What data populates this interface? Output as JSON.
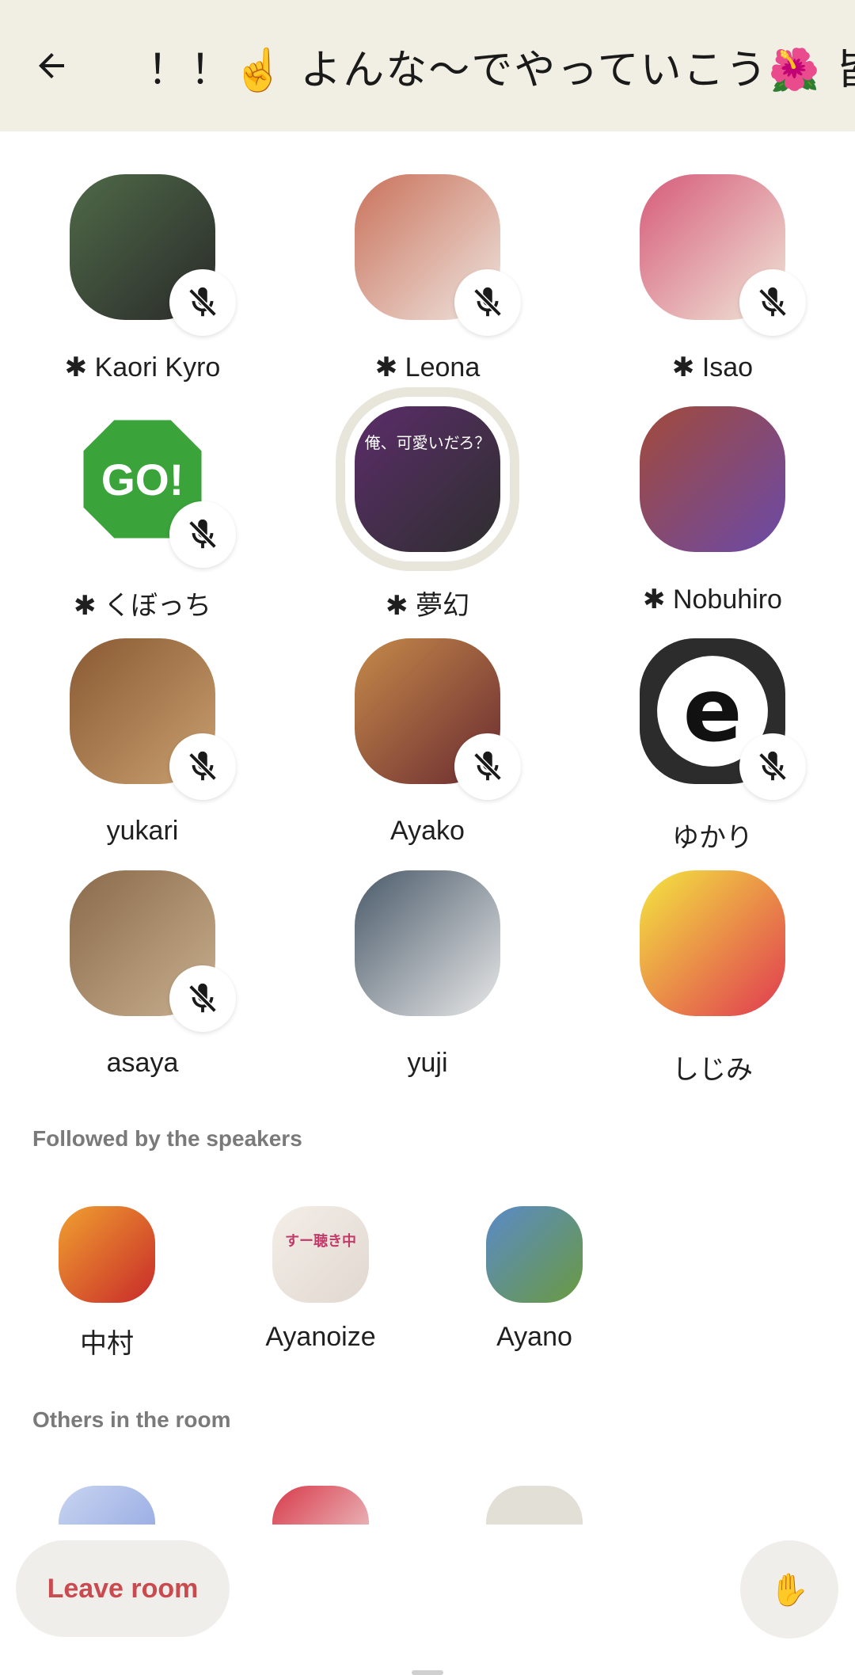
{
  "header": {
    "title": "！！☝️ よんな〜でやっていこう🌺 皆"
  },
  "speakers": [
    {
      "name": "✱ Kaori Kyro",
      "muted": true,
      "bg": [
        "#4f6a48",
        "#2a2a2a"
      ]
    },
    {
      "name": "✱ Leona",
      "muted": true,
      "bg": [
        "#c9725a",
        "#efe5e0"
      ]
    },
    {
      "name": "✱ Isao",
      "muted": true,
      "bg": [
        "#d65a7a",
        "#f0e8d8"
      ]
    },
    {
      "name": "✱ くぼっち",
      "muted": true,
      "bg": [
        "#ffffff",
        "#ffffff"
      ],
      "icon": "go-sign",
      "sign_text": "GO!"
    },
    {
      "name": "✱ 夢幻",
      "muted": false,
      "bg": [
        "#5b2d6a",
        "#2e2e2e"
      ],
      "caption": "俺、可愛いだろ？",
      "ring": true
    },
    {
      "name": "✱ Nobuhiro",
      "muted": false,
      "bg": [
        "#a24a3a",
        "#6a4aa8"
      ]
    },
    {
      "name": "yukari",
      "muted": true,
      "bg": [
        "#8a5a32",
        "#c9a070"
      ]
    },
    {
      "name": "Ayako",
      "muted": true,
      "bg": [
        "#c58a4a",
        "#6a2a30"
      ]
    },
    {
      "name": "ゆかり",
      "muted": true,
      "bg": [
        "#333333",
        "#ffffff"
      ],
      "icon": "e-logo"
    },
    {
      "name": "asaya",
      "muted": true,
      "bg": [
        "#8a6a4a",
        "#c9b090"
      ]
    },
    {
      "name": "yuji",
      "muted": false,
      "bg": [
        "#4a5a6a",
        "#e8e8e8"
      ]
    },
    {
      "name": "しじみ",
      "muted": false,
      "bg": [
        "#f4e640",
        "#e03a50"
      ]
    }
  ],
  "followed_section": {
    "title": "Followed by the speakers",
    "users": [
      {
        "name": "中村",
        "bg": [
          "#f0a030",
          "#c82a2a"
        ]
      },
      {
        "name": "Ayanoize",
        "bg": [
          "#f4eee8",
          "#e0d8d0"
        ],
        "caption": "すー聴き中"
      },
      {
        "name": "Ayano",
        "bg": [
          "#5a8ac8",
          "#6a9a40"
        ]
      }
    ]
  },
  "others_section": {
    "title": "Others in the room",
    "users": [
      {
        "bg": [
          "#c8d4f0",
          "#8aa0e0"
        ]
      },
      {
        "bg": [
          "#d83a4a",
          "#f0e0e0"
        ]
      },
      {
        "bg": [
          "#e2dfd6",
          "#e2dfd6"
        ]
      }
    ]
  },
  "footer": {
    "leave_label": "Leave room",
    "hand_icon": "✋"
  },
  "colors": {
    "header_bg": "#f1efe4",
    "leave_text": "#c94a4f",
    "button_bg": "#f0eeeb"
  }
}
